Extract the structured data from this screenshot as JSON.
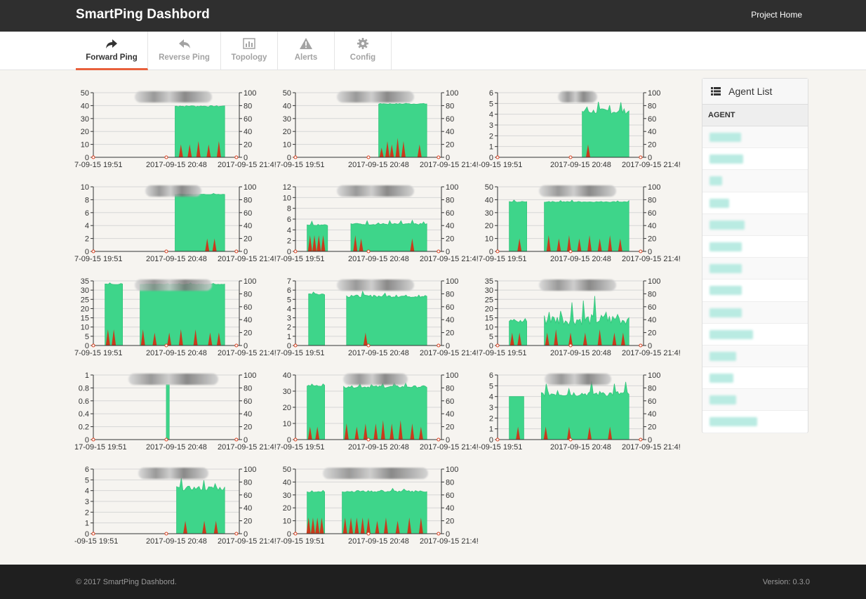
{
  "header": {
    "title": "SmartPing Dashbord",
    "project_home": "Project Home"
  },
  "tabs": [
    {
      "label": "Forward Ping",
      "icon": "share-icon",
      "active": true
    },
    {
      "label": "Reverse Ping",
      "icon": "reply-icon",
      "active": false
    },
    {
      "label": "Topology",
      "icon": "bar-chart-icon",
      "active": false
    },
    {
      "label": "Alerts",
      "icon": "warning-icon",
      "active": false
    },
    {
      "label": "Config",
      "icon": "gear-icon",
      "active": false
    }
  ],
  "agent_list": {
    "title": "Agent List",
    "column": "AGENT",
    "row_count": 14
  },
  "footer": {
    "copyright": "© 2017 SmartPing Dashbord.",
    "version": "Version: 0.3.0"
  },
  "colors": {
    "delay": "#3ed58a",
    "loss": "#c93a1c",
    "accent": "#e8603c",
    "topbar": "#2f2f2f",
    "footer": "#1f1f1f"
  },
  "chart_data": [
    {
      "type": "area",
      "x_labels": [
        "7-09-15 19:51",
        "2017-09-15 20:48",
        "2017-09-15 21:4!"
      ],
      "y_left_ticks": [
        0,
        10,
        20,
        30,
        40,
        50
      ],
      "y_right_ticks": [
        0,
        20,
        40,
        60,
        80,
        100
      ],
      "ylim": [
        0,
        50
      ],
      "y2lim": [
        0,
        100
      ],
      "x_range": [
        0,
        1
      ],
      "delay_segments": [
        [
          0.56,
          0.9,
          39,
          42
        ]
      ],
      "loss_peaks": [
        [
          0.6,
          20
        ],
        [
          0.66,
          20
        ],
        [
          0.72,
          25
        ],
        [
          0.79,
          20
        ],
        [
          0.86,
          25
        ]
      ]
    },
    {
      "type": "area",
      "x_labels": [
        "7-09-15 19:51",
        "2017-09-15 20:48",
        "2017-09-15 21:4!"
      ],
      "y_left_ticks": [
        0,
        10,
        20,
        30,
        40,
        50
      ],
      "y_right_ticks": [
        0,
        20,
        40,
        60,
        80,
        100
      ],
      "ylim": [
        0,
        50
      ],
      "y2lim": [
        0,
        100
      ],
      "x_range": [
        0,
        1
      ],
      "delay_segments": [
        [
          0.57,
          0.9,
          41,
          43
        ]
      ],
      "loss_peaks": [
        [
          0.59,
          15
        ],
        [
          0.63,
          25
        ],
        [
          0.66,
          20
        ],
        [
          0.7,
          30
        ],
        [
          0.74,
          25
        ],
        [
          0.85,
          20
        ]
      ]
    },
    {
      "type": "area",
      "x_labels": [
        "-09-15 19:51",
        "2017-09-15 20:48",
        "2017-09-15 21:4!"
      ],
      "y_left_ticks": [
        0,
        1,
        2,
        3,
        4,
        5,
        6
      ],
      "y_right_ticks": [
        0,
        20,
        40,
        60,
        80,
        100
      ],
      "ylim": [
        0,
        6
      ],
      "y2lim": [
        0,
        100
      ],
      "x_range": [
        0,
        1
      ],
      "delay_segments": [
        [
          0.58,
          0.9,
          4,
          5.5
        ]
      ],
      "loss_peaks": [
        [
          0.62,
          20
        ]
      ]
    },
    {
      "type": "area",
      "x_labels": [
        "7-09-15 19:51",
        "2017-09-15 20:48",
        "2017-09-15 21:4!"
      ],
      "y_left_ticks": [
        0,
        2,
        4,
        6,
        8,
        10
      ],
      "y_right_ticks": [
        0,
        20,
        40,
        60,
        80,
        100
      ],
      "ylim": [
        0,
        10
      ],
      "y2lim": [
        0,
        100
      ],
      "x_range": [
        0,
        1
      ],
      "delay_segments": [
        [
          0.56,
          0.9,
          8.8,
          9
        ]
      ],
      "loss_peaks": [
        [
          0.78,
          20
        ],
        [
          0.83,
          20
        ]
      ]
    },
    {
      "type": "area",
      "x_labels": [
        "7-09-15 19:51",
        "2017-09-15 20:48",
        "2017-09-15 21:4!"
      ],
      "y_left_ticks": [
        0,
        2,
        4,
        6,
        8,
        10,
        12
      ],
      "y_right_ticks": [
        0,
        20,
        40,
        60,
        80,
        100
      ],
      "ylim": [
        0,
        12
      ],
      "y2lim": [
        0,
        100
      ],
      "x_range": [
        0,
        1
      ],
      "delay_segments": [
        [
          0.08,
          0.22,
          4.8,
          5.8
        ],
        [
          0.38,
          0.9,
          4.9,
          5.8
        ]
      ],
      "loss_peaks": [
        [
          0.1,
          25
        ],
        [
          0.13,
          25
        ],
        [
          0.16,
          25
        ],
        [
          0.19,
          25
        ],
        [
          0.41,
          25
        ],
        [
          0.45,
          20
        ],
        [
          0.8,
          20
        ]
      ]
    },
    {
      "type": "area",
      "x_labels": [
        "7-09-15 19:51",
        "2017-09-15 20:48",
        "2017-09-15 21:4!"
      ],
      "y_left_ticks": [
        0,
        10,
        20,
        30,
        40,
        50
      ],
      "y_right_ticks": [
        0,
        20,
        40,
        60,
        80,
        100
      ],
      "ylim": [
        0,
        50
      ],
      "y2lim": [
        0,
        100
      ],
      "x_range": [
        0,
        1
      ],
      "delay_segments": [
        [
          0.08,
          0.2,
          38,
          40
        ],
        [
          0.32,
          0.9,
          38,
          40
        ]
      ],
      "loss_peaks": [
        [
          0.15,
          20
        ],
        [
          0.35,
          25
        ],
        [
          0.42,
          20
        ],
        [
          0.49,
          25
        ],
        [
          0.56,
          20
        ],
        [
          0.63,
          25
        ],
        [
          0.7,
          20
        ],
        [
          0.77,
          25
        ],
        [
          0.84,
          20
        ]
      ]
    },
    {
      "type": "area",
      "x_labels": [
        "7-09-15 19:51",
        "2017-09-15 20:48",
        "2017-09-15 21:4!"
      ],
      "y_left_ticks": [
        0,
        5,
        10,
        15,
        20,
        25,
        30,
        35
      ],
      "y_right_ticks": [
        0,
        20,
        40,
        60,
        80,
        100
      ],
      "ylim": [
        0,
        35
      ],
      "y2lim": [
        0,
        100
      ],
      "x_range": [
        0,
        1
      ],
      "delay_segments": [
        [
          0.08,
          0.2,
          33,
          34
        ],
        [
          0.32,
          0.9,
          33,
          34
        ]
      ],
      "loss_peaks": [
        [
          0.1,
          25
        ],
        [
          0.14,
          25
        ],
        [
          0.34,
          25
        ],
        [
          0.42,
          20
        ],
        [
          0.52,
          20
        ],
        [
          0.6,
          25
        ],
        [
          0.7,
          25
        ],
        [
          0.8,
          20
        ],
        [
          0.86,
          20
        ]
      ]
    },
    {
      "type": "area",
      "x_labels": [
        "7-09-15 19:51",
        "2017-09-15 20:48",
        "2017-09-15 21:4!"
      ],
      "y_left_ticks": [
        0,
        1,
        2,
        3,
        4,
        5,
        6,
        7
      ],
      "y_right_ticks": [
        0,
        20,
        40,
        60,
        80,
        100
      ],
      "ylim": [
        0,
        7
      ],
      "y2lim": [
        0,
        100
      ],
      "x_range": [
        0,
        1
      ],
      "delay_segments": [
        [
          0.09,
          0.2,
          5.5,
          6
        ],
        [
          0.35,
          0.9,
          5.2,
          6
        ]
      ],
      "loss_peaks": [
        [
          0.48,
          20
        ]
      ]
    },
    {
      "type": "area",
      "x_labels": [
        "7-09-15 19:51",
        "2017-09-15 20:48",
        "2017-09-15 21:4!"
      ],
      "y_left_ticks": [
        0,
        5,
        10,
        15,
        20,
        25,
        30,
        35
      ],
      "y_right_ticks": [
        0,
        20,
        40,
        60,
        80,
        100
      ],
      "ylim": [
        0,
        35
      ],
      "y2lim": [
        0,
        100
      ],
      "x_range": [
        0,
        1
      ],
      "delay_segments": [
        [
          0.08,
          0.2,
          12,
          18
        ],
        [
          0.32,
          0.9,
          11,
          28
        ]
      ],
      "loss_peaks": [
        [
          0.1,
          20
        ],
        [
          0.15,
          20
        ],
        [
          0.34,
          20
        ],
        [
          0.4,
          25
        ],
        [
          0.5,
          20
        ],
        [
          0.6,
          20
        ],
        [
          0.7,
          25
        ],
        [
          0.8,
          20
        ],
        [
          0.86,
          20
        ]
      ]
    },
    {
      "type": "area",
      "x_labels": [
        "17-09-15 19:51",
        "2017-09-15 20:48",
        "2017-09-15 21:4!"
      ],
      "y_left_ticks": [
        0,
        0.2,
        0.4,
        0.6,
        0.8,
        1
      ],
      "y_right_ticks": [
        0,
        20,
        40,
        60,
        80,
        100
      ],
      "ylim": [
        0,
        1
      ],
      "y2lim": [
        0,
        100
      ],
      "x_range": [
        0,
        1
      ],
      "delay_segments": [
        [
          0.5,
          0.52,
          0.85,
          0.85
        ]
      ],
      "loss_peaks": []
    },
    {
      "type": "area",
      "x_labels": [
        "7-09-15 19:51",
        "2017-09-15 20:48",
        "2017-09-15 21:4!"
      ],
      "y_left_ticks": [
        0,
        10,
        20,
        30,
        40
      ],
      "y_right_ticks": [
        0,
        20,
        40,
        60,
        80,
        100
      ],
      "ylim": [
        0,
        40
      ],
      "y2lim": [
        0,
        100
      ],
      "x_range": [
        0,
        1
      ],
      "delay_segments": [
        [
          0.08,
          0.2,
          33,
          35
        ],
        [
          0.33,
          0.9,
          32,
          36
        ]
      ],
      "loss_peaks": [
        [
          0.1,
          20
        ],
        [
          0.15,
          20
        ],
        [
          0.35,
          25
        ],
        [
          0.42,
          20
        ],
        [
          0.48,
          25
        ],
        [
          0.55,
          25
        ],
        [
          0.6,
          30
        ],
        [
          0.66,
          25
        ],
        [
          0.72,
          30
        ],
        [
          0.8,
          25
        ],
        [
          0.86,
          20
        ]
      ]
    },
    {
      "type": "area",
      "x_labels": [
        "-09-15 19:51",
        "2017-09-15 20:48",
        "2017-09-15 21:4!"
      ],
      "y_left_ticks": [
        0,
        1,
        2,
        3,
        4,
        5,
        6
      ],
      "y_right_ticks": [
        0,
        20,
        40,
        60,
        80,
        100
      ],
      "ylim": [
        0,
        6
      ],
      "y2lim": [
        0,
        100
      ],
      "x_range": [
        0,
        1
      ],
      "delay_segments": [
        [
          0.08,
          0.18,
          4,
          4
        ],
        [
          0.3,
          0.9,
          4,
          5.5
        ]
      ],
      "loss_peaks": [
        [
          0.14,
          20
        ],
        [
          0.33,
          20
        ],
        [
          0.49,
          20
        ],
        [
          0.63,
          20
        ],
        [
          0.77,
          20
        ]
      ]
    },
    {
      "type": "area",
      "x_labels": [
        "-09-15 19:51",
        "2017-09-15 20:48",
        "2017-09-15 21:4!"
      ],
      "y_left_ticks": [
        0,
        1,
        2,
        3,
        4,
        5,
        6
      ],
      "y_right_ticks": [
        0,
        20,
        40,
        60,
        80,
        100
      ],
      "ylim": [
        0,
        6
      ],
      "y2lim": [
        0,
        100
      ],
      "x_range": [
        0,
        1
      ],
      "delay_segments": [
        [
          0.57,
          0.9,
          4,
          5.2
        ]
      ],
      "loss_peaks": [
        [
          0.63,
          20
        ],
        [
          0.76,
          20
        ],
        [
          0.84,
          20
        ]
      ]
    },
    {
      "type": "area",
      "x_labels": [
        "7-09-15 19:51",
        "2017-09-15 20:48",
        "2017-09-15 21:4!"
      ],
      "y_left_ticks": [
        0,
        10,
        20,
        30,
        40,
        50
      ],
      "y_right_ticks": [
        0,
        20,
        40,
        60,
        80,
        100
      ],
      "ylim": [
        0,
        50
      ],
      "y2lim": [
        0,
        100
      ],
      "x_range": [
        0,
        1
      ],
      "delay_segments": [
        [
          0.08,
          0.2,
          32,
          34
        ],
        [
          0.32,
          0.9,
          32,
          36
        ]
      ],
      "loss_peaks": [
        [
          0.09,
          25
        ],
        [
          0.12,
          25
        ],
        [
          0.15,
          25
        ],
        [
          0.18,
          25
        ],
        [
          0.34,
          25
        ],
        [
          0.38,
          25
        ],
        [
          0.42,
          25
        ],
        [
          0.46,
          25
        ],
        [
          0.5,
          25
        ],
        [
          0.56,
          20
        ],
        [
          0.62,
          25
        ],
        [
          0.7,
          20
        ],
        [
          0.78,
          25
        ],
        [
          0.86,
          25
        ]
      ]
    }
  ]
}
